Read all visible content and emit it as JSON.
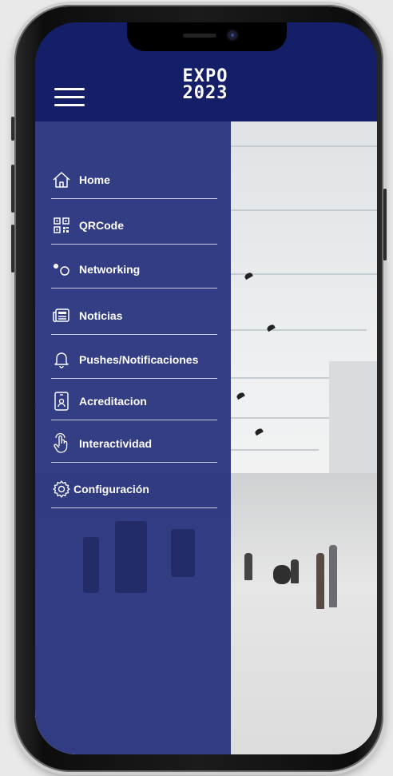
{
  "header": {
    "logo_line1": "EXPO",
    "logo_line2": "2023"
  },
  "menu": {
    "items": [
      {
        "label": "Home",
        "icon": "home-icon"
      },
      {
        "label": "QRCode",
        "icon": "qrcode-icon"
      },
      {
        "label": "Networking",
        "icon": "networking-icon"
      },
      {
        "label": "Noticias",
        "icon": "news-icon"
      },
      {
        "label": "Pushes/Notificaciones",
        "icon": "bell-icon"
      },
      {
        "label": "Acreditacion",
        "icon": "badge-icon"
      },
      {
        "label": "Interactividad",
        "icon": "touch-icon"
      },
      {
        "label": "Configuración",
        "icon": "gear-icon"
      }
    ]
  },
  "colors": {
    "header_bg": "#141f67",
    "drawer_bg": "#1f2a78",
    "text": "#ffffff"
  }
}
